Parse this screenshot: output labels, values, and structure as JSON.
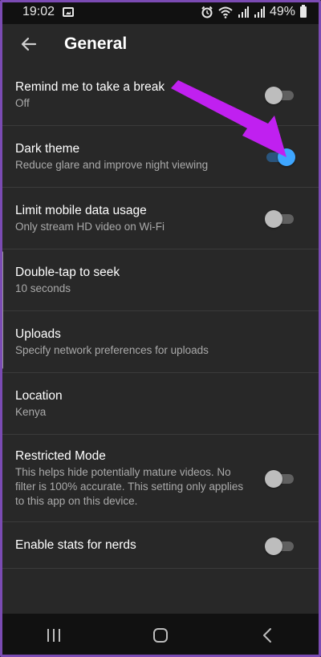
{
  "status_bar": {
    "time": "19:02",
    "battery": "49%"
  },
  "header": {
    "title": "General"
  },
  "settings": [
    {
      "title": "Remind me to take a break",
      "subtitle": "Off",
      "toggle": false
    },
    {
      "title": "Dark theme",
      "subtitle": "Reduce glare and improve night viewing",
      "toggle": true
    },
    {
      "title": "Limit mobile data usage",
      "subtitle": "Only stream HD video on Wi-Fi",
      "toggle": false
    },
    {
      "title": "Double-tap to seek",
      "subtitle": "10 seconds"
    },
    {
      "title": "Uploads",
      "subtitle": "Specify network preferences for uploads"
    },
    {
      "title": "Location",
      "subtitle": "Kenya"
    },
    {
      "title": "Restricted Mode",
      "subtitle": "This helps hide potentially mature videos. No filter is 100% accurate. This setting only applies to this app on this device.",
      "toggle": false
    },
    {
      "title": "Enable stats for nerds",
      "toggle": false
    }
  ],
  "colors": {
    "background": "#282828",
    "toggle_on_knob": "#3ea6ff",
    "toggle_off_knob": "#bdbdbd",
    "annotation_arrow": "#c020f0"
  },
  "icons": {
    "back": "arrow-left-icon",
    "nav_recent": "recent-apps-icon",
    "nav_home": "home-icon",
    "nav_back": "nav-back-icon"
  }
}
